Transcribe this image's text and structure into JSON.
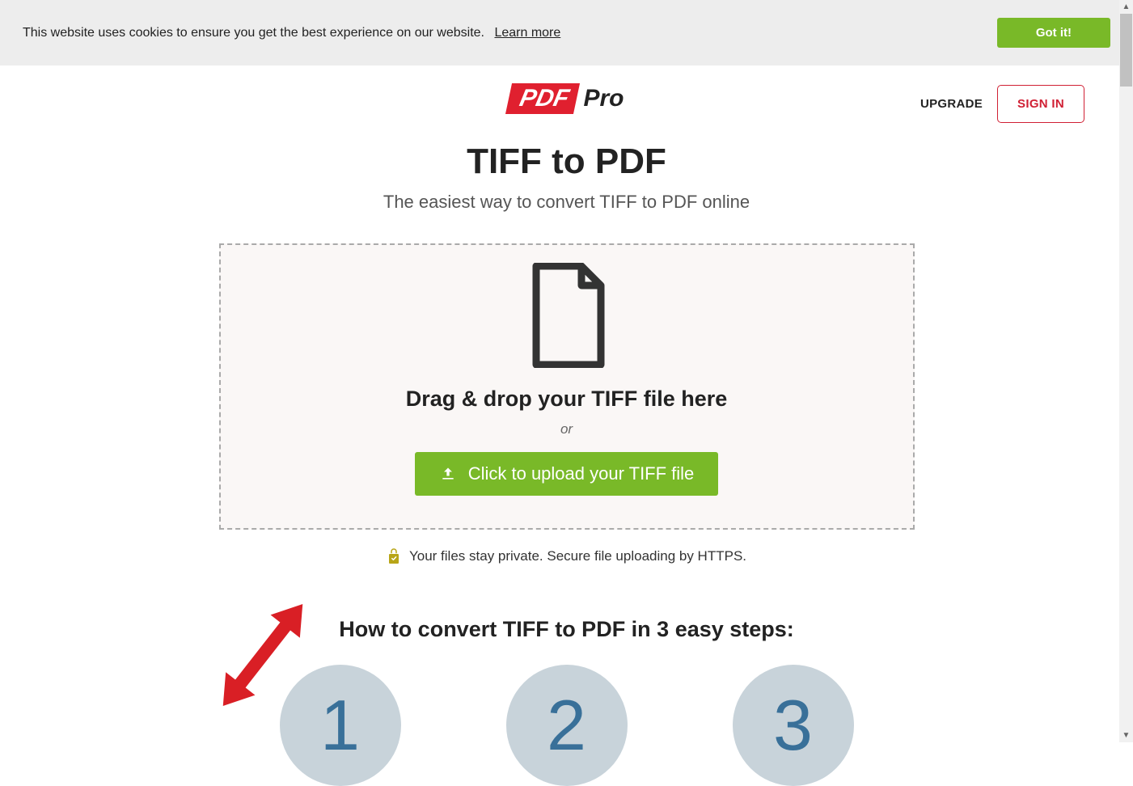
{
  "cookie": {
    "message": "This website uses cookies to ensure you get the best experience on our website.",
    "learn_more": "Learn more",
    "gotit": "Got it!"
  },
  "header": {
    "logo_pdf": "PDF",
    "logo_pro": "Pro",
    "upgrade": "UPGRADE",
    "signin": "SIGN IN"
  },
  "main": {
    "title": "TIFF to PDF",
    "subtitle": "The easiest way to convert TIFF to PDF online",
    "drop_text": "Drag & drop your TIFF file here",
    "or": "or",
    "upload_label": "Click to upload your TIFF file",
    "security_text": "Your files stay private. Secure file uploading by HTTPS."
  },
  "steps": {
    "title": "How to convert TIFF to PDF in 3 easy steps:",
    "numbers": [
      "1",
      "2",
      "3"
    ]
  }
}
